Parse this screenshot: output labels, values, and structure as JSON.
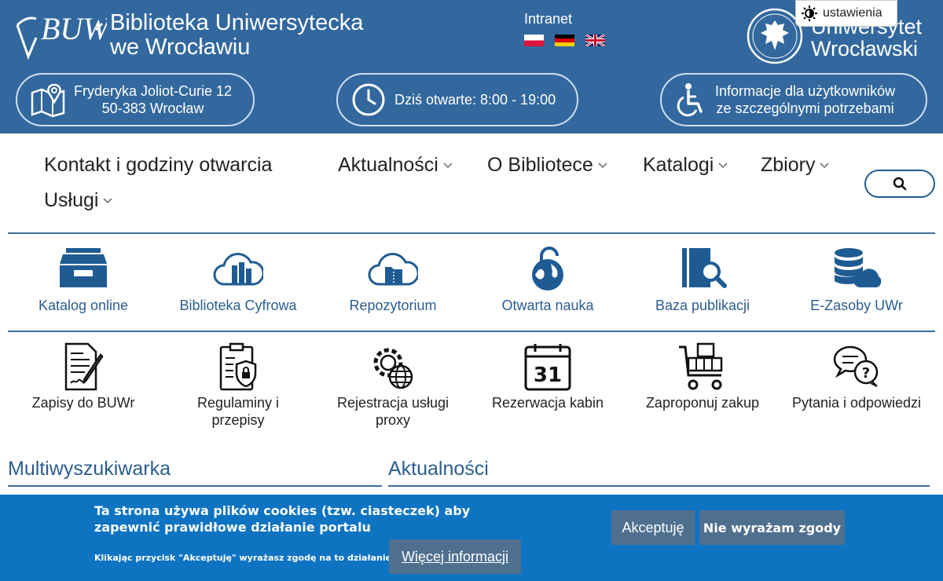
{
  "header": {
    "library_name_line1": "Biblioteka Uniwersytecka",
    "library_name_line2": "we Wrocławiu",
    "logo_icon": "buwr-logo",
    "intranet_label": "Intranet",
    "languages": [
      "pl-flag-icon",
      "de-flag-icon",
      "en-flag-icon"
    ],
    "university_name_line1": "Uniwersytet",
    "university_name_line2": "Wrocławski",
    "settings_label": "ustawienia"
  },
  "info_pills": {
    "address_line1": "Fryderyka Joliot-Curie 12",
    "address_line2": "50-383 Wrocław",
    "hours": "Dziś otwarte: 8:00 - 19:00",
    "accessibility_line1": "Informacje dla użytkowników",
    "accessibility_line2": "ze szczególnymi potrzebami"
  },
  "nav": {
    "items": [
      {
        "label": "Kontakt i godziny otwarcia"
      },
      {
        "label": "Aktualności"
      },
      {
        "label": "O Bibliotece"
      },
      {
        "label": "Katalogi"
      },
      {
        "label": "Zbiory"
      },
      {
        "label": "Usługi"
      }
    ]
  },
  "tiles_row1": [
    {
      "label": "Katalog online",
      "icon": "archive-box-icon"
    },
    {
      "label": "Biblioteka Cyfrowa",
      "icon": "cloud-books-icon"
    },
    {
      "label": "Repozytorium",
      "icon": "cloud-folder-icon"
    },
    {
      "label": "Otwarta nauka",
      "icon": "open-lock-globe-icon"
    },
    {
      "label": "Baza publikacji",
      "icon": "book-search-icon"
    },
    {
      "label": "E-Zasoby UWr",
      "icon": "database-cloud-icon"
    }
  ],
  "tiles_row2": [
    {
      "label": "Zapisy do BUWr",
      "icon": "document-signature-icon"
    },
    {
      "label_line1": "Regulaminy i",
      "label_line2": "przepisy",
      "icon": "clipboard-lock-icon"
    },
    {
      "label_line1": "Rejestracja usługi",
      "label_line2": "proxy",
      "icon": "gear-globe-icon"
    },
    {
      "label": "Rezerwacja kabin",
      "icon": "calendar-31-icon",
      "calendar_day": "31"
    },
    {
      "label": "Zaproponuj zakup",
      "icon": "shopping-cart-icon"
    },
    {
      "label": "Pytania i odpowiedzi",
      "icon": "chat-question-icon"
    }
  ],
  "sections": {
    "left_title": "Multiwyszukiwarka",
    "right_title": "Aktualności"
  },
  "cookie_banner": {
    "message": "Ta strona używa plików cookies (tzw. ciasteczek) aby zapewnić prawidłowe działanie portalu",
    "note": "Klikając przycisk \"Akceptuję\" wyrażasz zgodę na to działanie.",
    "more_label": "Więcej informacji",
    "accept_label": "Akceptuję",
    "deny_label": "Nie wyrażam zgody"
  },
  "colors": {
    "header_bg": "#32689e",
    "link_blue": "#2b5d8f",
    "icon_blue": "#1f5b93",
    "cookie_bg": "#0e74c2",
    "button_bg": "#4f6f8f"
  }
}
